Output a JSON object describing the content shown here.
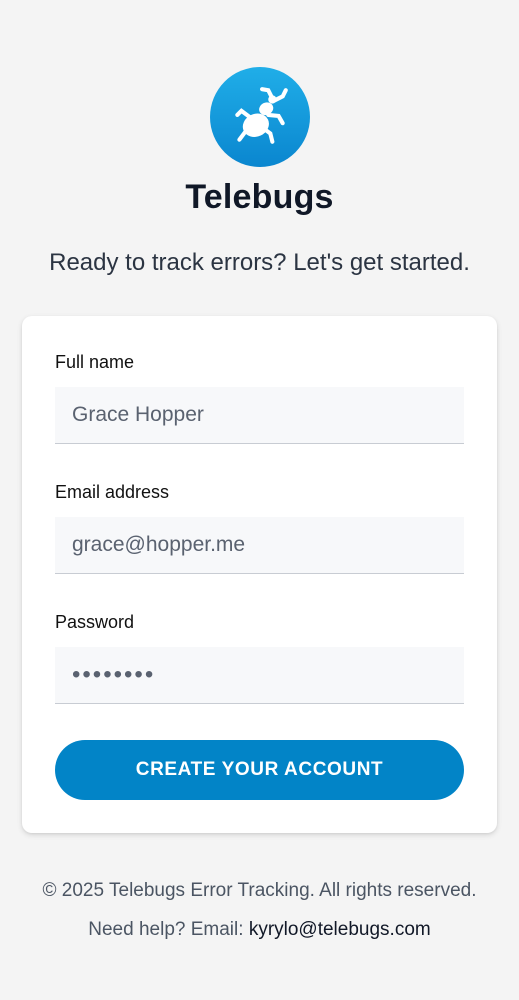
{
  "app": {
    "logo_icon": "bug-icon",
    "name": "Telebugs",
    "tagline": "Ready to track errors? Let's get started."
  },
  "form": {
    "full_name": {
      "label": "Full name",
      "value": "Grace Hopper"
    },
    "email": {
      "label": "Email address",
      "value": "grace@hopper.me"
    },
    "password": {
      "label": "Password",
      "value": "••••••••"
    },
    "submit_label": "CREATE YOUR ACCOUNT"
  },
  "footer": {
    "copyright": "© 2025 Telebugs Error Tracking. All rights reserved.",
    "help_prefix": "Need help? Email:",
    "help_email": "kyrylo@telebugs.com"
  },
  "colors": {
    "accent": "#0284c7",
    "page_background": "#f4f4f4",
    "card_background": "#ffffff"
  }
}
